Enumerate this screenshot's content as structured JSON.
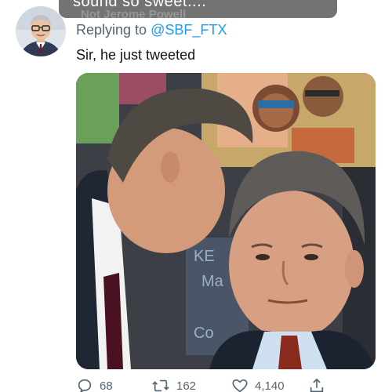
{
  "toast": {
    "text": "sound so sweet....",
    "ghost_text": "Not Jerome Powell"
  },
  "tweet": {
    "replying_prefix": "Replying to",
    "replying_handle": "@SBF_FTX",
    "text": "Sir, he just tweeted"
  },
  "actions": {
    "replies": "68",
    "retweets": "162",
    "likes": "4,140"
  },
  "icons": {
    "reply": "reply-icon",
    "retweet": "retweet-icon",
    "like": "heart-icon",
    "share": "share-icon"
  },
  "colors": {
    "link": "#1d9bf0",
    "secondary_text": "#536471",
    "primary_text": "#0f1419"
  }
}
